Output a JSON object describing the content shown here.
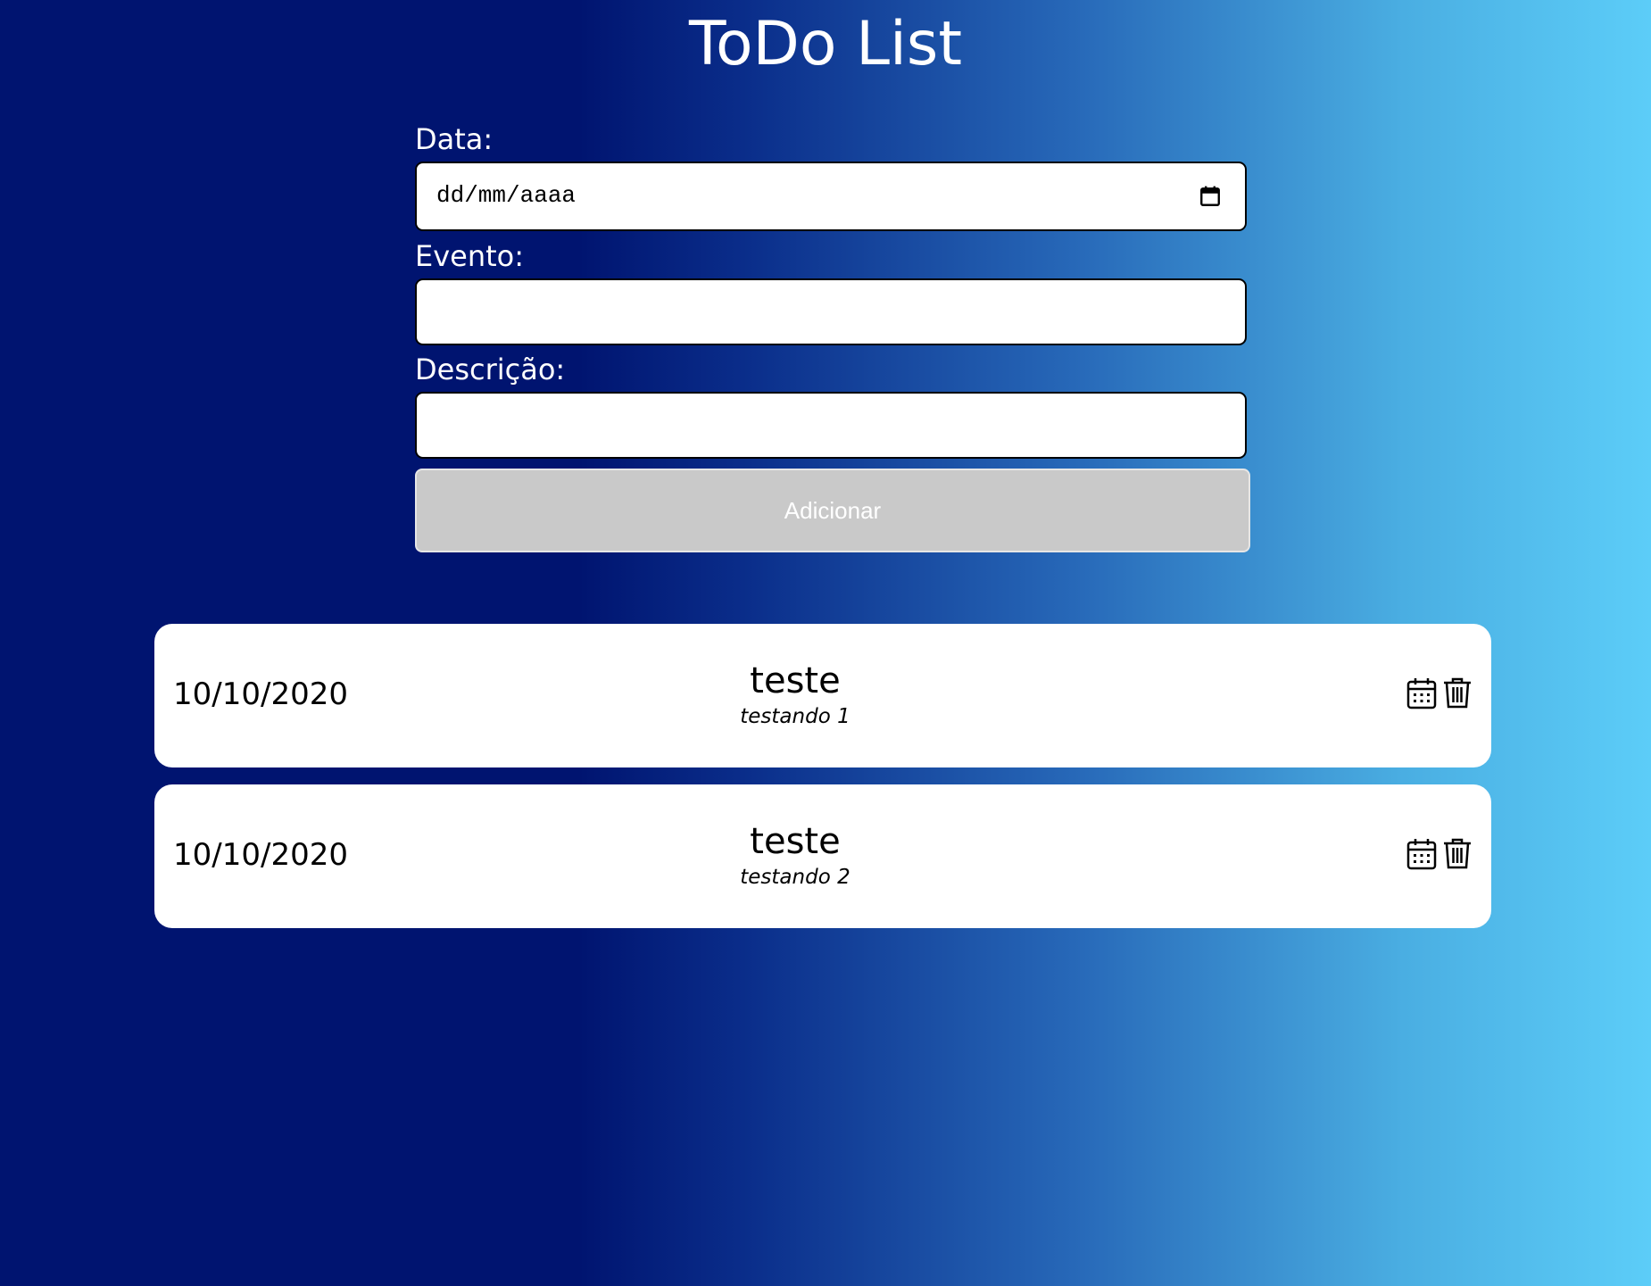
{
  "header": {
    "title": "ToDo List"
  },
  "form": {
    "date_label": "Data:",
    "date_placeholder": "dd/mm/aaaa",
    "event_label": "Evento:",
    "event_value": "",
    "description_label": "Descrição:",
    "description_value": "",
    "add_button_label": "Adicionar"
  },
  "items": [
    {
      "date": "10/10/2020",
      "event": "teste",
      "description": "testando 1",
      "actions": [
        "calendar-icon",
        "trash-icon"
      ]
    },
    {
      "date": "10/10/2020",
      "event": "teste",
      "description": "testando 2",
      "actions": [
        "calendar-icon",
        "trash-icon"
      ]
    }
  ],
  "colors": {
    "background_start": "#001470",
    "background_end": "#5ccdf8",
    "button_disabled": "#c9c9c9",
    "card_background": "#ffffff"
  }
}
